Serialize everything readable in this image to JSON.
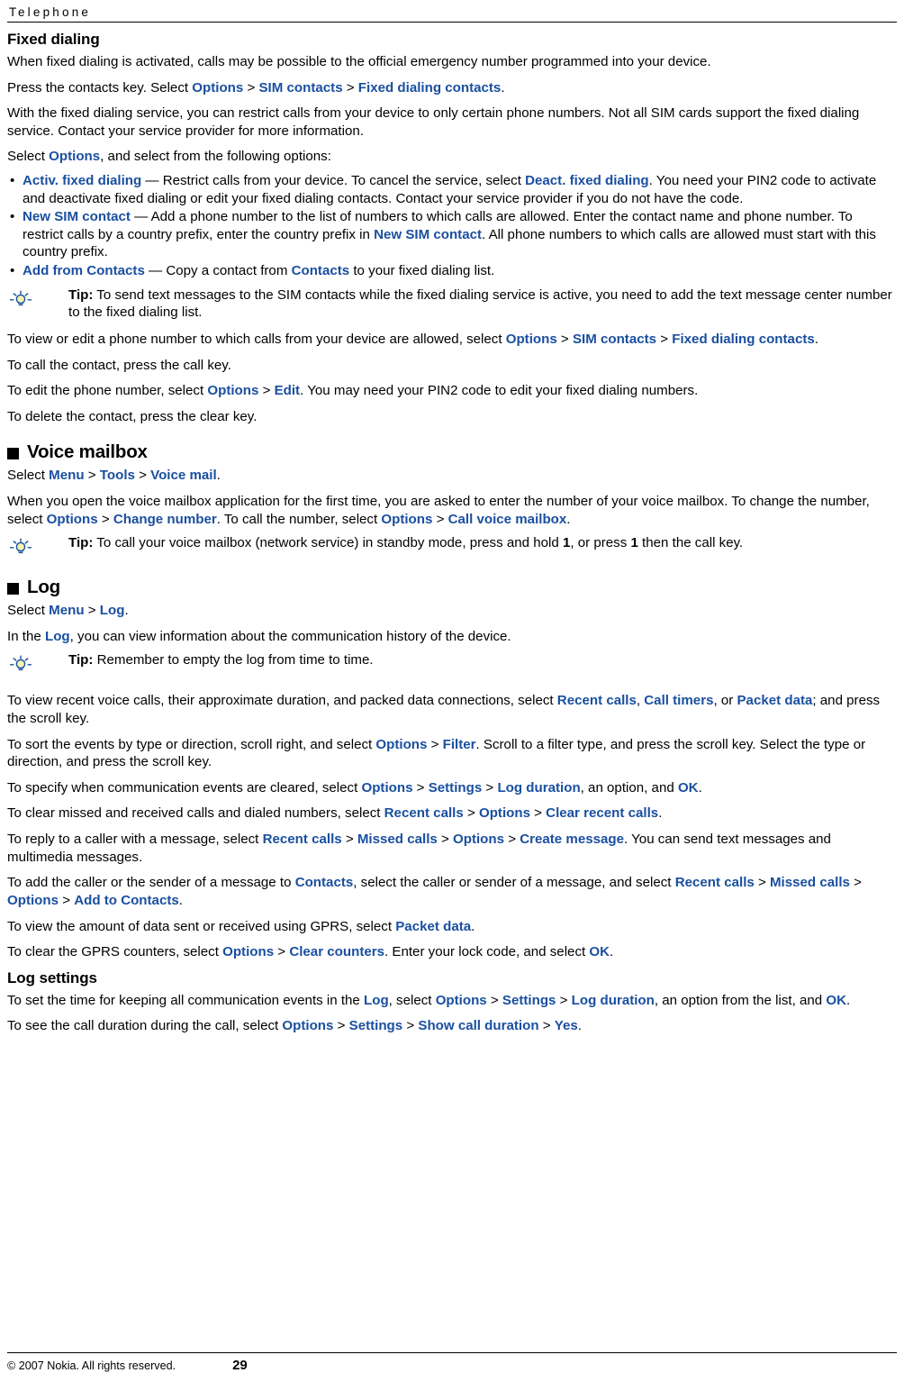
{
  "header": {
    "title": "Telephone"
  },
  "sections": {
    "fixed_dialing": {
      "heading": "Fixed dialing",
      "p1": "When fixed dialing is activated, calls may be possible to the official emergency number programmed into your device.",
      "p2_a": "Press the contacts key. Select ",
      "p2_opt1": "Options",
      "p2_gt1": " > ",
      "p2_opt2": "SIM contacts",
      "p2_gt2": " > ",
      "p2_opt3": "Fixed dialing contacts",
      "p2_end": ".",
      "p3": "With the fixed dialing service, you can restrict calls from your device to only certain phone numbers. Not all SIM cards support the fixed dialing service. Contact your service provider for more information.",
      "p4_a": "Select ",
      "p4_opt": "Options",
      "p4_b": ", and select from the following options:",
      "bullets": [
        {
          "term": "Activ. fixed dialing",
          "t1": " — Restrict calls from your device. To cancel the service, select ",
          "link1": "Deact. fixed dialing",
          "t2": ". You need your PIN2 code to activate and deactivate fixed dialing or edit your fixed dialing contacts. Contact your service provider if you do not have the code."
        },
        {
          "term": "New SIM contact",
          "t1": " — Add a phone number to the list of numbers to which calls are allowed. Enter the contact name and phone number. To restrict calls by a country prefix, enter the country prefix in ",
          "link1": "New SIM contact",
          "t2": ". All phone numbers to which calls are allowed must start with this country prefix."
        },
        {
          "term": "Add from Contacts",
          "t1": " — Copy a contact from ",
          "link1": "Contacts",
          "t2": " to your fixed dialing list."
        }
      ],
      "tip1_label": "Tip:",
      "tip1_text": " To send text messages to the SIM contacts while the fixed dialing service is active, you need to add the text message center number to the fixed dialing list.",
      "p5_a": "To view or edit a phone number to which calls from your device are allowed, select ",
      "p5_opt1": "Options",
      "p5_gt1": " > ",
      "p5_opt2": "SIM contacts",
      "p5_gt2": " > ",
      "p5_opt3": "Fixed dialing contacts",
      "p5_end": ".",
      "p6": "To call the contact, press the call key.",
      "p7_a": "To edit the phone number, select ",
      "p7_opt1": "Options",
      "p7_gt1": " > ",
      "p7_opt2": "Edit",
      "p7_b": ". You may need your PIN2 code to edit your fixed dialing numbers.",
      "p8": "To delete the contact, press the clear key."
    },
    "voice_mailbox": {
      "heading": "Voice mailbox",
      "p1_a": "Select ",
      "p1_opt1": "Menu",
      "p1_gt1": " > ",
      "p1_opt2": "Tools",
      "p1_gt2": " > ",
      "p1_opt3": "Voice mail",
      "p1_end": ".",
      "p2_a": "When you open the voice mailbox application for the first time, you are asked to enter the number of your voice mailbox. To change the number, select ",
      "p2_opt1": "Options",
      "p2_gt1": " > ",
      "p2_opt2": "Change number",
      "p2_b": ". To call the number, select ",
      "p2_opt3": "Options",
      "p2_gt2": " > ",
      "p2_opt4": "Call voice mailbox",
      "p2_end": ".",
      "tip_label": "Tip:",
      "tip_a": " To call your voice mailbox (network service) in standby mode, press and hold ",
      "tip_key1": "1",
      "tip_b": ", or press ",
      "tip_key2": "1",
      "tip_c": " then the call key."
    },
    "log": {
      "heading": "Log",
      "p1_a": "Select ",
      "p1_opt1": "Menu",
      "p1_gt1": " > ",
      "p1_opt2": "Log",
      "p1_end": ".",
      "p2_a": "In the ",
      "p2_opt1": "Log",
      "p2_b": ", you can view information about the communication history of the device.",
      "tip_label": "Tip:",
      "tip_text": " Remember to empty the log from time to time.",
      "p3_a": "To view recent voice calls, their approximate duration, and packed data connections, select ",
      "p3_opt1": "Recent calls",
      "p3_c1": ", ",
      "p3_opt2": "Call timers",
      "p3_c2": ", or ",
      "p3_opt3": "Packet data",
      "p3_b": "; and press the scroll key.",
      "p4_a": "To sort the events by type or direction, scroll right, and select ",
      "p4_opt1": "Options",
      "p4_gt1": " > ",
      "p4_opt2": "Filter",
      "p4_b": ". Scroll to a filter type, and press the scroll key. Select the type or direction, and press the scroll key.",
      "p5_a": "To specify when communication events are cleared, select ",
      "p5_opt1": "Options",
      "p5_gt1": " > ",
      "p5_opt2": "Settings",
      "p5_gt2": " > ",
      "p5_opt3": "Log duration",
      "p5_b": ", an option, and ",
      "p5_opt4": "OK",
      "p5_end": ".",
      "p6_a": "To clear missed and received calls and dialed numbers, select ",
      "p6_opt1": "Recent calls",
      "p6_gt1": " > ",
      "p6_opt2": "Options",
      "p6_gt2": " > ",
      "p6_opt3": "Clear recent calls",
      "p6_end": ".",
      "p7_a": "To reply to a caller with a message, select ",
      "p7_opt1": "Recent calls",
      "p7_gt1": " > ",
      "p7_opt2": "Missed calls",
      "p7_gt2": " > ",
      "p7_opt3": "Options",
      "p7_gt3": " > ",
      "p7_opt4": "Create message",
      "p7_b": ". You can send text messages and multimedia messages.",
      "p8_a": "To add the caller or the sender of a message to ",
      "p8_opt1": "Contacts",
      "p8_b": ", select the caller or sender of a message, and select ",
      "p8_opt2": "Recent calls",
      "p8_gt1": " > ",
      "p8_opt3": "Missed calls",
      "p8_gt2": " > ",
      "p8_opt4": "Options",
      "p8_gt3": " > ",
      "p8_opt5": "Add to Contacts",
      "p8_end": ".",
      "p9_a": "To view the amount of data sent or received using GPRS, select ",
      "p9_opt1": "Packet data",
      "p9_end": ".",
      "p10_a": "To clear the GPRS counters, select ",
      "p10_opt1": "Options",
      "p10_gt1": " > ",
      "p10_opt2": "Clear counters",
      "p10_b": ". Enter your lock code, and select ",
      "p10_opt3": "OK",
      "p10_end": "."
    },
    "log_settings": {
      "heading": "Log settings",
      "p1_a": "To set the time for keeping all communication events in the ",
      "p1_opt1": "Log",
      "p1_b": ", select ",
      "p1_opt2": "Options",
      "p1_gt1": " > ",
      "p1_opt3": "Settings",
      "p1_gt2": " > ",
      "p1_opt4": "Log duration",
      "p1_c": ", an option from the list, and ",
      "p1_opt5": "OK",
      "p1_end": ".",
      "p2_a": "To see the call duration during the call, select ",
      "p2_opt1": "Options",
      "p2_gt1": " > ",
      "p2_opt2": "Settings",
      "p2_gt2": " > ",
      "p2_opt3": "Show call duration",
      "p2_gt3": " > ",
      "p2_opt4": "Yes",
      "p2_end": "."
    }
  },
  "footer": {
    "copyright": "© 2007 Nokia. All rights reserved.",
    "page_number": "29"
  },
  "colors": {
    "link": "#1a4fa0",
    "text": "#000000",
    "background": "#ffffff"
  }
}
